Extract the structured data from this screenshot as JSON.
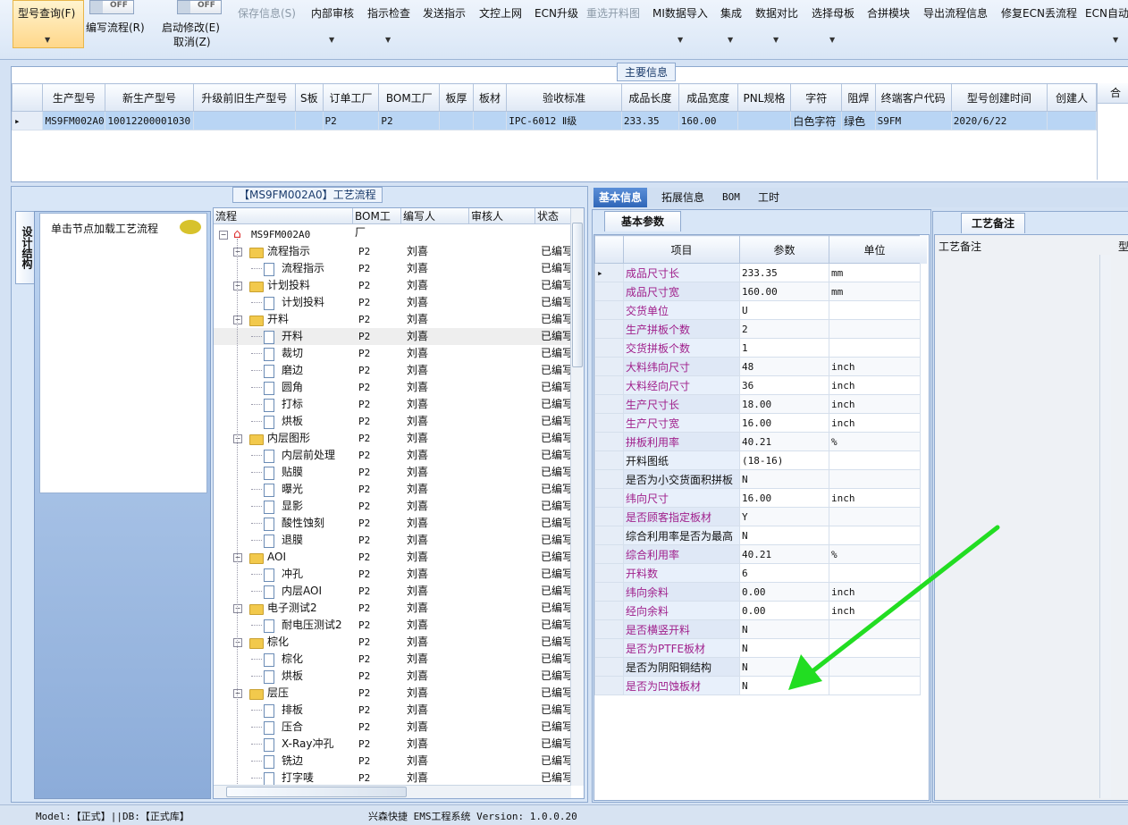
{
  "ribbon": {
    "buttons": [
      {
        "label": "型号查询(F)",
        "disabled": false,
        "dropdown": true
      },
      {
        "label": "编写流程(R)",
        "disabled": false,
        "dropdown": false
      },
      {
        "label": "启动修改(E)",
        "disabled": false,
        "dropdown": false
      },
      {
        "label": "取消(Z)",
        "disabled": false,
        "dropdown": false
      },
      {
        "label": "保存信息(S)",
        "disabled": true,
        "dropdown": false
      },
      {
        "label": "内部审核",
        "disabled": false,
        "dropdown": true
      },
      {
        "label": "指示检查",
        "disabled": false,
        "dropdown": true
      },
      {
        "label": "发送指示",
        "disabled": false,
        "dropdown": false
      },
      {
        "label": "文控上网",
        "disabled": false,
        "dropdown": false
      },
      {
        "label": "ECN升级",
        "disabled": false,
        "dropdown": false
      },
      {
        "label": "重选开料图",
        "disabled": true,
        "dropdown": false
      },
      {
        "label": "MI数据导入",
        "disabled": false,
        "dropdown": true
      },
      {
        "label": "集成",
        "disabled": false,
        "dropdown": true
      },
      {
        "label": "数据对比",
        "disabled": false,
        "dropdown": true
      },
      {
        "label": "选择母板",
        "disabled": false,
        "dropdown": true
      },
      {
        "label": "合拼模块",
        "disabled": false,
        "dropdown": false
      },
      {
        "label": "导出流程信息",
        "disabled": false,
        "dropdown": false
      },
      {
        "label": "修复ECN丢流程",
        "disabled": false,
        "dropdown": false
      },
      {
        "label": "ECN自动上",
        "disabled": false,
        "dropdown": true
      }
    ],
    "toggles": [
      {
        "label": "OFF"
      },
      {
        "label": "OFF"
      }
    ]
  },
  "main_info": {
    "title": "主要信息",
    "columns": [
      "生产型号",
      "新生产型号",
      "升级前旧生产型号",
      "S板",
      "订单工厂",
      "BOM工厂",
      "板厚",
      "板材",
      "验收标准",
      "成品长度",
      "成品宽度",
      "PNL规格",
      "字符",
      "阻焊",
      "终端客户代码",
      "型号创建时间",
      "创建人"
    ],
    "rows": [
      [
        "MS9FM002A0",
        "10012200001030",
        "",
        "",
        "P2",
        "P2",
        "",
        "",
        "IPC-6012 Ⅱ级",
        "233.35",
        "160.00",
        "",
        "白色字符",
        "绿色",
        "S9FM",
        "2020/6/22",
        ""
      ]
    ],
    "side_header": "合"
  },
  "process": {
    "title": "【MS9FM002A0】工艺流程",
    "side_tab": "设计结构",
    "nav_item": "单击节点加载工艺流程",
    "tree_headers": [
      "流程",
      "BOM工厂",
      "编写人",
      "审核人",
      "状态"
    ],
    "root": "MS9FM002A0",
    "rows": [
      {
        "label": "流程指示",
        "type": "folder",
        "factory": "P2",
        "writer": "刘喜",
        "status": "已编写"
      },
      {
        "label": "流程指示",
        "type": "doc",
        "factory": "P2",
        "writer": "刘喜",
        "status": "已编写"
      },
      {
        "label": "计划投料",
        "type": "folder",
        "factory": "P2",
        "writer": "刘喜",
        "status": "已编写"
      },
      {
        "label": "计划投料",
        "type": "doc",
        "factory": "P2",
        "writer": "刘喜",
        "status": "已编写"
      },
      {
        "label": "开料",
        "type": "folder",
        "factory": "P2",
        "writer": "刘喜",
        "status": "已编写"
      },
      {
        "label": "开料",
        "type": "doc",
        "factory": "P2",
        "writer": "刘喜",
        "status": "已编写",
        "highlight": true
      },
      {
        "label": "裁切",
        "type": "doc",
        "factory": "P2",
        "writer": "刘喜",
        "status": "已编写"
      },
      {
        "label": "磨边",
        "type": "doc",
        "factory": "P2",
        "writer": "刘喜",
        "status": "已编写"
      },
      {
        "label": "圆角",
        "type": "doc",
        "factory": "P2",
        "writer": "刘喜",
        "status": "已编写"
      },
      {
        "label": "打标",
        "type": "doc",
        "factory": "P2",
        "writer": "刘喜",
        "status": "已编写"
      },
      {
        "label": "烘板",
        "type": "doc",
        "factory": "P2",
        "writer": "刘喜",
        "status": "已编写"
      },
      {
        "label": "内层图形",
        "type": "folder",
        "factory": "P2",
        "writer": "刘喜",
        "status": "已编写"
      },
      {
        "label": "内层前处理",
        "type": "doc",
        "factory": "P2",
        "writer": "刘喜",
        "status": "已编写"
      },
      {
        "label": "贴膜",
        "type": "doc",
        "factory": "P2",
        "writer": "刘喜",
        "status": "已编写"
      },
      {
        "label": "曝光",
        "type": "doc",
        "factory": "P2",
        "writer": "刘喜",
        "status": "已编写"
      },
      {
        "label": "显影",
        "type": "doc",
        "factory": "P2",
        "writer": "刘喜",
        "status": "已编写"
      },
      {
        "label": "酸性蚀刻",
        "type": "doc",
        "factory": "P2",
        "writer": "刘喜",
        "status": "已编写"
      },
      {
        "label": "退膜",
        "type": "doc",
        "factory": "P2",
        "writer": "刘喜",
        "status": "已编写"
      },
      {
        "label": "AOI",
        "type": "folder",
        "factory": "P2",
        "writer": "刘喜",
        "status": "已编写"
      },
      {
        "label": "冲孔",
        "type": "doc",
        "factory": "P2",
        "writer": "刘喜",
        "status": "已编写"
      },
      {
        "label": "内层AOI",
        "type": "doc",
        "factory": "P2",
        "writer": "刘喜",
        "status": "已编写"
      },
      {
        "label": "电子测试2",
        "type": "folder",
        "factory": "P2",
        "writer": "刘喜",
        "status": "已编写"
      },
      {
        "label": "耐电压测试2",
        "type": "doc",
        "factory": "P2",
        "writer": "刘喜",
        "status": "已编写"
      },
      {
        "label": "棕化",
        "type": "folder",
        "factory": "P2",
        "writer": "刘喜",
        "status": "已编写"
      },
      {
        "label": "棕化",
        "type": "doc",
        "factory": "P2",
        "writer": "刘喜",
        "status": "已编写"
      },
      {
        "label": "烘板",
        "type": "doc",
        "factory": "P2",
        "writer": "刘喜",
        "status": "已编写"
      },
      {
        "label": "层压",
        "type": "folder",
        "factory": "P2",
        "writer": "刘喜",
        "status": "已编写"
      },
      {
        "label": "排板",
        "type": "doc",
        "factory": "P2",
        "writer": "刘喜",
        "status": "已编写"
      },
      {
        "label": "压合",
        "type": "doc",
        "factory": "P2",
        "writer": "刘喜",
        "status": "已编写"
      },
      {
        "label": "X-Ray冲孔",
        "type": "doc",
        "factory": "P2",
        "writer": "刘喜",
        "status": "已编写"
      },
      {
        "label": "铣边",
        "type": "doc",
        "factory": "P2",
        "writer": "刘喜",
        "status": "已编写"
      },
      {
        "label": "打字唛",
        "type": "doc",
        "factory": "P2",
        "writer": "刘喜",
        "status": "已编写"
      }
    ]
  },
  "right_tabs": [
    "基本信息",
    "拓展信息",
    "BOM",
    "工时"
  ],
  "basic": {
    "tab": "基本参数",
    "headers": [
      "项目",
      "参数",
      "单位"
    ],
    "rows": [
      {
        "k": "成品尺寸长",
        "v": "233.35",
        "u": "mm",
        "pink": true
      },
      {
        "k": "成品尺寸宽",
        "v": "160.00",
        "u": "mm",
        "pink": true
      },
      {
        "k": "交货单位",
        "v": "U",
        "u": "",
        "pink": true
      },
      {
        "k": "生产拼板个数",
        "v": "2",
        "u": "",
        "pink": true
      },
      {
        "k": "交货拼板个数",
        "v": "1",
        "u": "",
        "pink": true
      },
      {
        "k": "大料纬向尺寸",
        "v": "48",
        "u": "inch",
        "pink": true
      },
      {
        "k": "大料经向尺寸",
        "v": "36",
        "u": "inch",
        "pink": true
      },
      {
        "k": "生产尺寸长",
        "v": "18.00",
        "u": "inch",
        "pink": true
      },
      {
        "k": "生产尺寸宽",
        "v": "16.00",
        "u": "inch",
        "pink": true
      },
      {
        "k": "拼板利用率",
        "v": "40.21",
        "u": "%",
        "pink": true
      },
      {
        "k": "开料图纸",
        "v": "(18-16)",
        "u": "",
        "pink": false
      },
      {
        "k": "是否为小交货面积拼板",
        "v": "N",
        "u": "",
        "pink": false
      },
      {
        "k": "纬向尺寸",
        "v": "16.00",
        "u": "inch",
        "pink": true
      },
      {
        "k": "是否顾客指定板材",
        "v": "Y",
        "u": "",
        "pink": true
      },
      {
        "k": "综合利用率是否为最高",
        "v": "N",
        "u": "",
        "pink": false
      },
      {
        "k": "综合利用率",
        "v": "40.21",
        "u": "%",
        "pink": true
      },
      {
        "k": "开料数",
        "v": "6",
        "u": "",
        "pink": true
      },
      {
        "k": "纬向余料",
        "v": "0.00",
        "u": "inch",
        "pink": true
      },
      {
        "k": "经向余料",
        "v": "0.00",
        "u": "inch",
        "pink": true
      },
      {
        "k": "是否横竖开料",
        "v": "N",
        "u": "",
        "pink": true
      },
      {
        "k": "是否为PTFE板材",
        "v": "N",
        "u": "",
        "pink": true
      },
      {
        "k": "是否为阴阳铜结构",
        "v": "N",
        "u": "",
        "pink": false
      },
      {
        "k": "是否为凹蚀板材",
        "v": "N",
        "u": "",
        "pink": true
      }
    ]
  },
  "remark": {
    "tab": "工艺备注",
    "column": "工艺备注",
    "column2": "型"
  },
  "status": {
    "left": "Model:【正式】||DB:【正式库】",
    "center": "兴森快捷 EMS工程系统 Version: 1.0.0.20"
  },
  "colors": {
    "accent": "#2f66b8",
    "selected_row": "#b9d5f4",
    "key_pink": "#a0208c",
    "arrow": "#22dd22"
  }
}
